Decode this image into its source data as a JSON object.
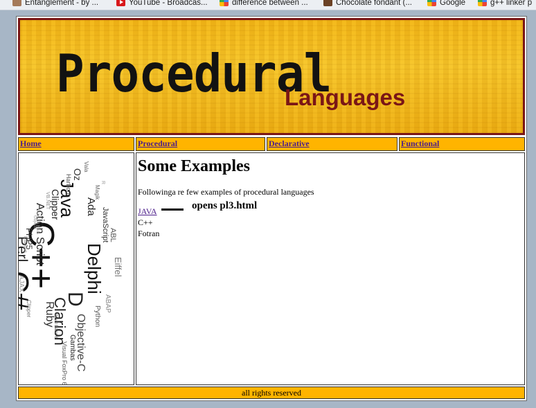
{
  "bookmarks": [
    {
      "label": "Entanglement - by ...",
      "icon": "entanglement-icon"
    },
    {
      "label": "YouTube - Broadcas...",
      "icon": "youtube-icon"
    },
    {
      "label": "difference between ...",
      "icon": "google-icon"
    },
    {
      "label": "Chocolate fondant (...",
      "icon": "chocolate-icon"
    },
    {
      "label": "Google",
      "icon": "google-icon"
    },
    {
      "label": "g++ linker p",
      "icon": "google-icon"
    }
  ],
  "banner": {
    "title": "Procedural",
    "subtitle": "Languages"
  },
  "nav": {
    "home": "Home",
    "procedural": "Procedural",
    "declarative": "Declarative",
    "functional": "Functional"
  },
  "main": {
    "heading": "Some Examples",
    "intro": "Followinga re few examples of procedural languages",
    "examples": [
      "JAVA",
      "C++",
      "Fotran"
    ],
    "annotation": "opens pl3.html"
  },
  "wordcloud": [
    "C++",
    "Java",
    "C#",
    "Delphi",
    "Action Script",
    "Perl",
    "D",
    "Clarion",
    "Objective-C",
    "Ruby",
    "Clipper",
    "Ada",
    "JavaScript",
    "Oz",
    "Eiffel",
    "PHP5",
    "ABAP",
    "Python",
    "Gambas",
    "Visual FoxPro 6",
    "AJAX",
    "ABL",
    "Harbour",
    "Magik",
    "Vala",
    "R",
    "VB.NET",
    "Visual Basic 6",
    "Objects",
    "Ruby on Rails",
    "Dialogue",
    "Clipper"
  ],
  "footer": "all rights reserved",
  "colors": {
    "nav_bg": "#ffb400",
    "banner_bg": "#f4b81a",
    "banner_border": "#7a1616",
    "link": "#4b1d8a"
  }
}
